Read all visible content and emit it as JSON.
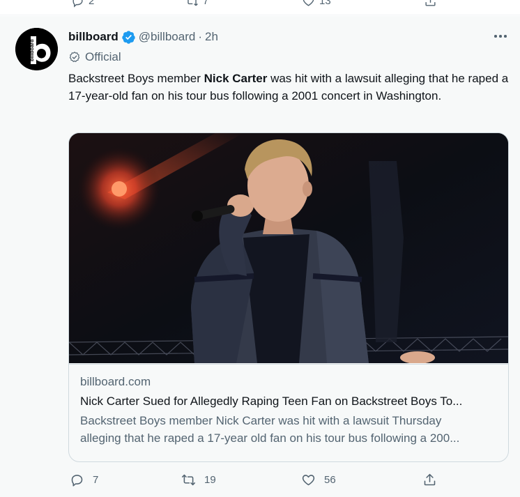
{
  "previous_tweet": {
    "actions": [
      {
        "name": "reply",
        "count": "2"
      },
      {
        "name": "retweet",
        "count": "7"
      },
      {
        "name": "like",
        "count": "13"
      },
      {
        "name": "share",
        "count": ""
      }
    ]
  },
  "tweet": {
    "author": {
      "display_name": "billboard",
      "handle": "@billboard",
      "separator": "·",
      "time": "2h",
      "verified": true,
      "badge_label": "Official",
      "avatar_text": "billboard"
    },
    "text_prefix": "Backstreet Boys member ",
    "text_bold": "Nick Carter",
    "text_suffix": " was hit with a lawsuit alleging that he raped a 17-year-old fan on his tour bus following a 2001 concert in Washington.",
    "card": {
      "domain": "billboard.com",
      "title": "Nick Carter Sued for Allegedly Raping Teen Fan on Backstreet Boys To...",
      "description_line1": "Backstreet Boys member Nick Carter was hit with a lawsuit Thursday",
      "description_line2": "alleging that he raped a 17-year old fan on his tour bus following a 200..."
    },
    "actions": {
      "reply_count": "7",
      "retweet_count": "19",
      "like_count": "56"
    }
  },
  "colors": {
    "verified_blue": "#1d9bf0",
    "secondary_text": "#536471",
    "primary_text": "#0f1419",
    "border": "#cfd9de",
    "tweet_bg": "#f7f9f9"
  },
  "icons": [
    "reply-icon",
    "retweet-icon",
    "like-icon",
    "share-icon",
    "more-icon",
    "verified-badge-icon",
    "official-badge-icon"
  ]
}
